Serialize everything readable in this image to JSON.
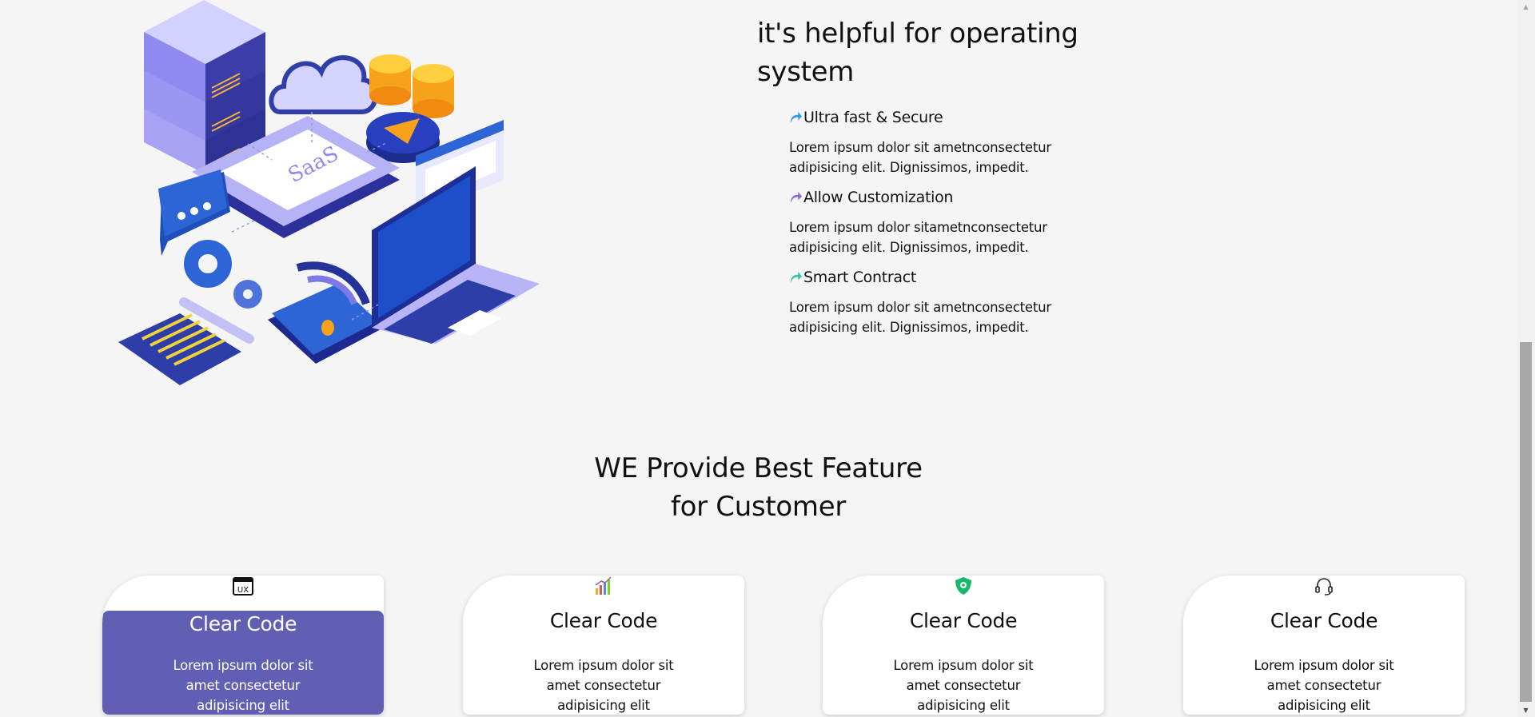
{
  "about": {
    "title_line1": "it's helpful for operating",
    "title_line2": "system",
    "illustration_label": "SaaS",
    "features": [
      {
        "title": "Ultra fast & Secure",
        "text": "Lorem ipsum dolor sit ametnconsectetur adipisicing elit. Dignissimos, impedit.",
        "icon": "share-arrow-icon",
        "color": "#2f9be8"
      },
      {
        "title": "Allow Customization",
        "text": "Lorem ipsum dolor sitametnconsectetur adipisicing elit. Dignissimos, impedit.",
        "icon": "share-arrow-icon",
        "color": "#8e6dc9"
      },
      {
        "title": "Smart Contract",
        "text": "Lorem ipsum dolor sit ametnconsectetur adipisicing elit. Dignissimos, impedit.",
        "icon": "share-arrow-icon",
        "color": "#3bbfa8"
      }
    ]
  },
  "features_section": {
    "title_line1": "WE Provide Best Feature",
    "title_line2": "for Customer",
    "cards": [
      {
        "icon": "ux-window-icon",
        "icon_text": "UX",
        "title": "Clear Code",
        "text": "Lorem ipsum dolor sit amet consectetur adipisicing elit",
        "active": true
      },
      {
        "icon": "bar-chart-icon",
        "title": "Clear Code",
        "text": "Lorem ipsum dolor sit amet consectetur adipisicing elit",
        "active": false
      },
      {
        "icon": "shield-icon",
        "title": "Clear Code",
        "text": "Lorem ipsum dolor sit amet consectetur adipisicing elit",
        "active": false
      },
      {
        "icon": "headset-icon",
        "title": "Clear Code",
        "text": "Lorem ipsum dolor sit amet consectetur adipisicing elit",
        "active": false
      }
    ]
  },
  "colors": {
    "accent": "#605fb4",
    "background": "#f5f5f5",
    "text": "#111111"
  }
}
